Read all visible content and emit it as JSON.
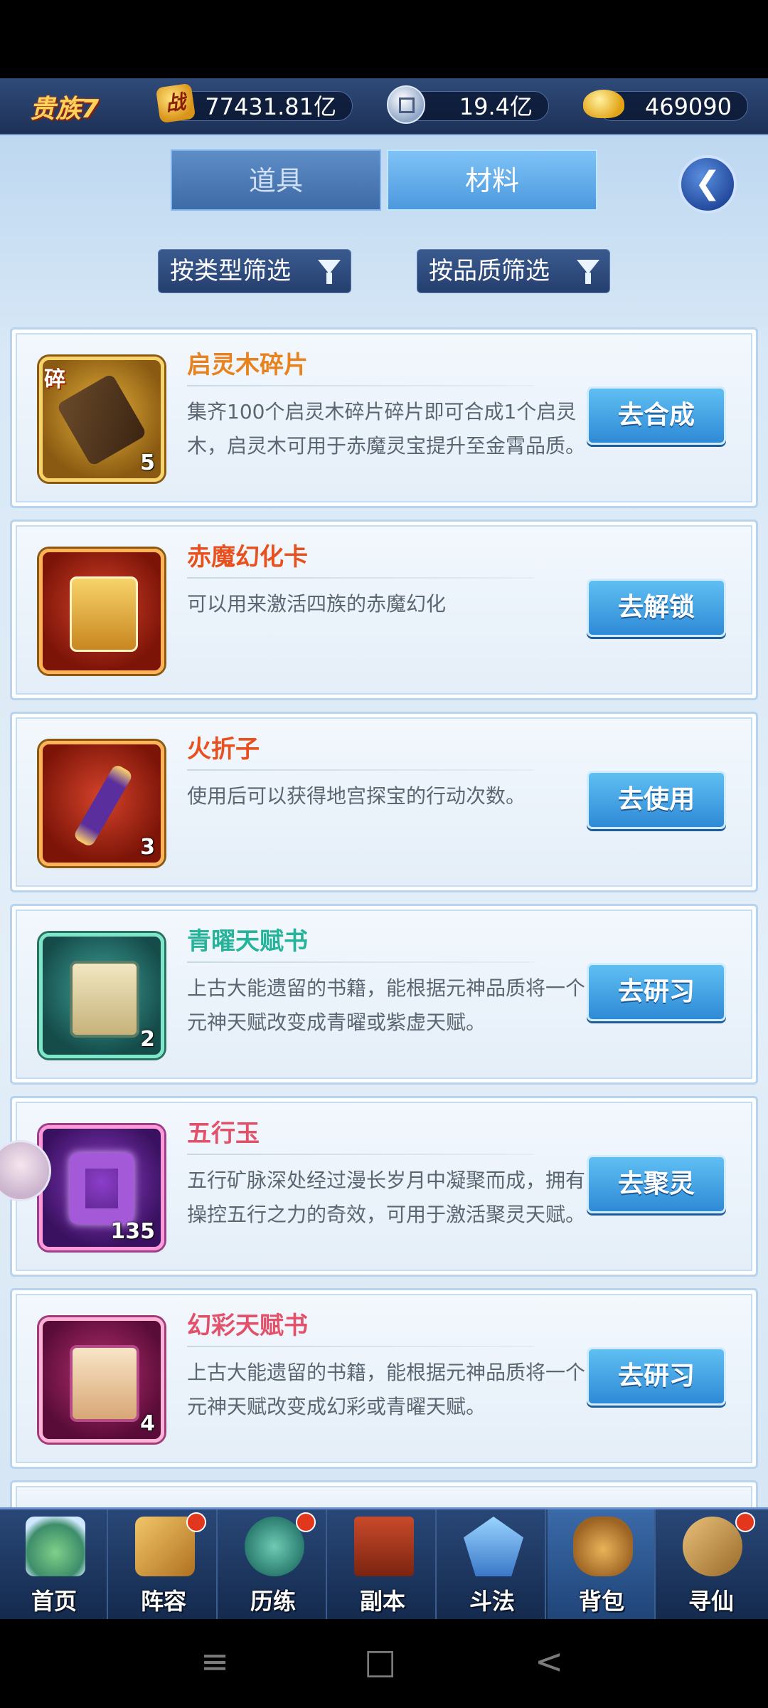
{
  "topbar": {
    "vip_label": "贵族7",
    "power_icon_text": "战",
    "power_value": "77431.81亿",
    "silver_value": "19.4亿",
    "gold_value": "469090"
  },
  "tabs": [
    {
      "label": "道具",
      "active": false
    },
    {
      "label": "材料",
      "active": true
    }
  ],
  "back_icon": "back-arrow-icon",
  "filters": {
    "by_type": "按类型筛选",
    "by_quality": "按品质筛选"
  },
  "items": [
    {
      "name": "启灵木碎片",
      "name_color": "#e8821e",
      "tag": "碎",
      "count": "5",
      "desc": "集齐100个启灵木碎片碎片即可合成1个启灵木，启灵木可用于赤魔灵宝提升至金霄品质。",
      "button": "去合成"
    },
    {
      "name": "赤魔幻化卡",
      "name_color": "#e8501e",
      "tag": "",
      "count": "",
      "desc": "可以用来激活四族的赤魔幻化",
      "button": "去解锁"
    },
    {
      "name": "火折子",
      "name_color": "#e8501e",
      "tag": "",
      "count": "3",
      "desc": "使用后可以获得地宫探宝的行动次数。",
      "button": "去使用"
    },
    {
      "name": "青曜天赋书",
      "name_color": "#25b39a",
      "tag": "",
      "count": "2",
      "desc": "上古大能遗留的书籍，能根据元神品质将一个元神天赋改变成青曜或紫虚天赋。",
      "button": "去研习"
    },
    {
      "name": "五行玉",
      "name_color": "#e2506a",
      "tag": "",
      "count": "135",
      "desc": "五行矿脉深处经过漫长岁月中凝聚而成，拥有操控五行之力的奇效，可用于激活聚灵天赋。",
      "button": "去聚灵"
    },
    {
      "name": "幻彩天赋书",
      "name_color": "#e2506a",
      "tag": "",
      "count": "4",
      "desc": "上古大能遗留的书籍，能根据元神品质将一个元神天赋改变成幻彩或青曜天赋。",
      "button": "去研习"
    }
  ],
  "nav": [
    {
      "label": "首页",
      "badge": false
    },
    {
      "label": "阵容",
      "badge": true
    },
    {
      "label": "历练",
      "badge": true
    },
    {
      "label": "副本",
      "badge": false
    },
    {
      "label": "斗法",
      "badge": false
    },
    {
      "label": "背包",
      "badge": false
    },
    {
      "label": "寻仙",
      "badge": true
    }
  ],
  "system_nav": {
    "menu": "≡",
    "home": "□",
    "back": "<"
  }
}
